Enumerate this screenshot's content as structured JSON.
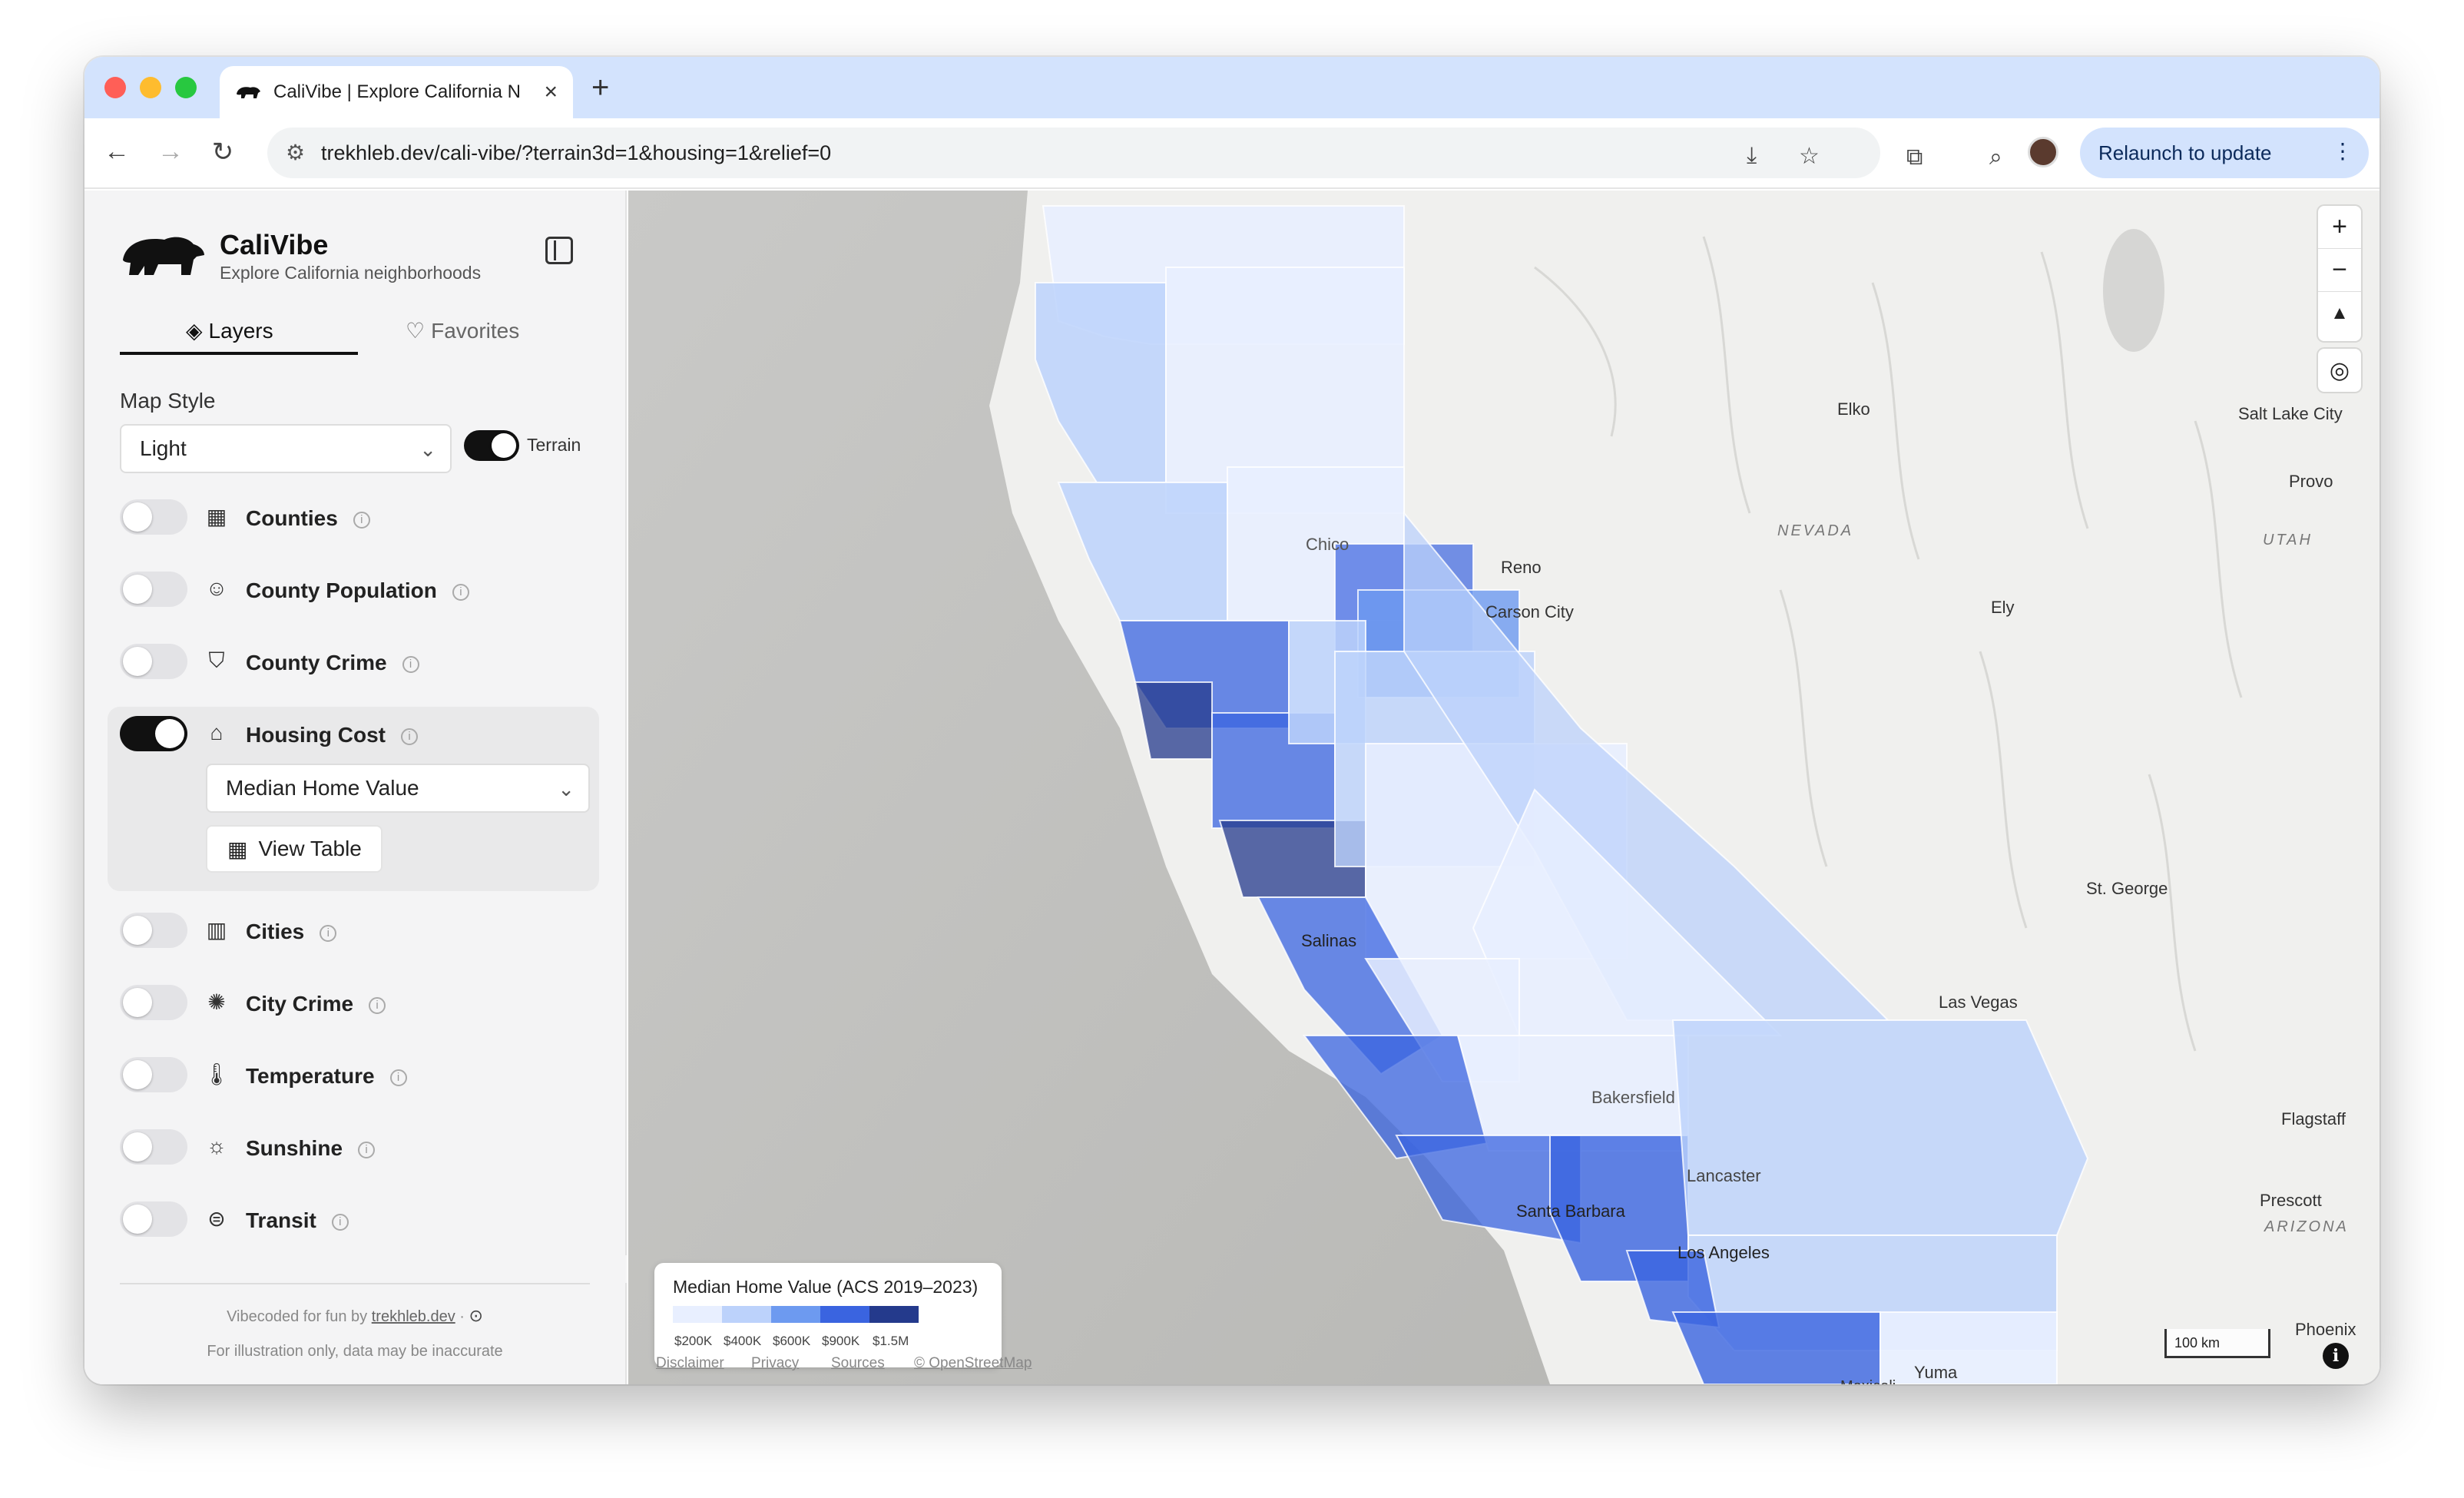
{
  "browser": {
    "tab_title": "CaliVibe | Explore California N",
    "url": "trekhleb.dev/cali-vibe/?terrain3d=1&housing=1&relief=0",
    "relaunch_label": "Relaunch to update"
  },
  "sidebar": {
    "brand_title": "CaliVibe",
    "brand_subtitle": "Explore California neighborhoods",
    "tabs": [
      {
        "label": "Layers",
        "active": true
      },
      {
        "label": "Favorites",
        "active": false
      }
    ],
    "map_style_label": "Map Style",
    "map_style_value": "Light",
    "terrain_label": "Terrain",
    "terrain_on": true,
    "layers": [
      {
        "label": "Counties",
        "icon": "map-icon",
        "on": false
      },
      {
        "label": "County Population",
        "icon": "users-icon",
        "on": false
      },
      {
        "label": "County Crime",
        "icon": "shield-icon",
        "on": false
      },
      {
        "label": "Housing Cost",
        "icon": "home-icon",
        "on": true
      },
      {
        "label": "Cities",
        "icon": "building-icon",
        "on": false
      },
      {
        "label": "City Crime",
        "icon": "siren-icon",
        "on": false
      },
      {
        "label": "Temperature",
        "icon": "thermometer-icon",
        "on": false
      },
      {
        "label": "Sunshine",
        "icon": "sun-icon",
        "on": false
      },
      {
        "label": "Transit",
        "icon": "bus-icon",
        "on": false
      }
    ],
    "housing_metric": "Median Home Value",
    "view_table_label": "View Table",
    "footer_prefix": "Vibecoded for fun by",
    "footer_link": "trekhleb.dev",
    "footer_note": "For illustration only, data may be inaccurate"
  },
  "map": {
    "places": [
      "Elko",
      "Salt Lake City",
      "Provo",
      "Reno",
      "Carson City",
      "Chico",
      "Ely",
      "St. George",
      "Las Vegas",
      "Salinas",
      "Bakersfield",
      "Flagstaff",
      "Prescott",
      "Lancaster",
      "Santa Barbara",
      "Los Angeles",
      "Phoenix",
      "Yuma",
      "Mexicali"
    ],
    "regions": [
      "NEVADA",
      "UTAH",
      "ARIZONA"
    ],
    "legend": {
      "title": "Median Home Value (ACS 2019–2023)",
      "labels": [
        "$200K",
        "$400K",
        "$600K",
        "$900K",
        "$1.5M"
      ],
      "colors": [
        "#e8efff",
        "#bcd2fb",
        "#6d9af0",
        "#3a64e0",
        "#243a8c"
      ]
    },
    "attribution": [
      "Disclaimer",
      "Privacy",
      "Sources",
      "© OpenStreetMap"
    ],
    "scale_label": "100 km"
  }
}
